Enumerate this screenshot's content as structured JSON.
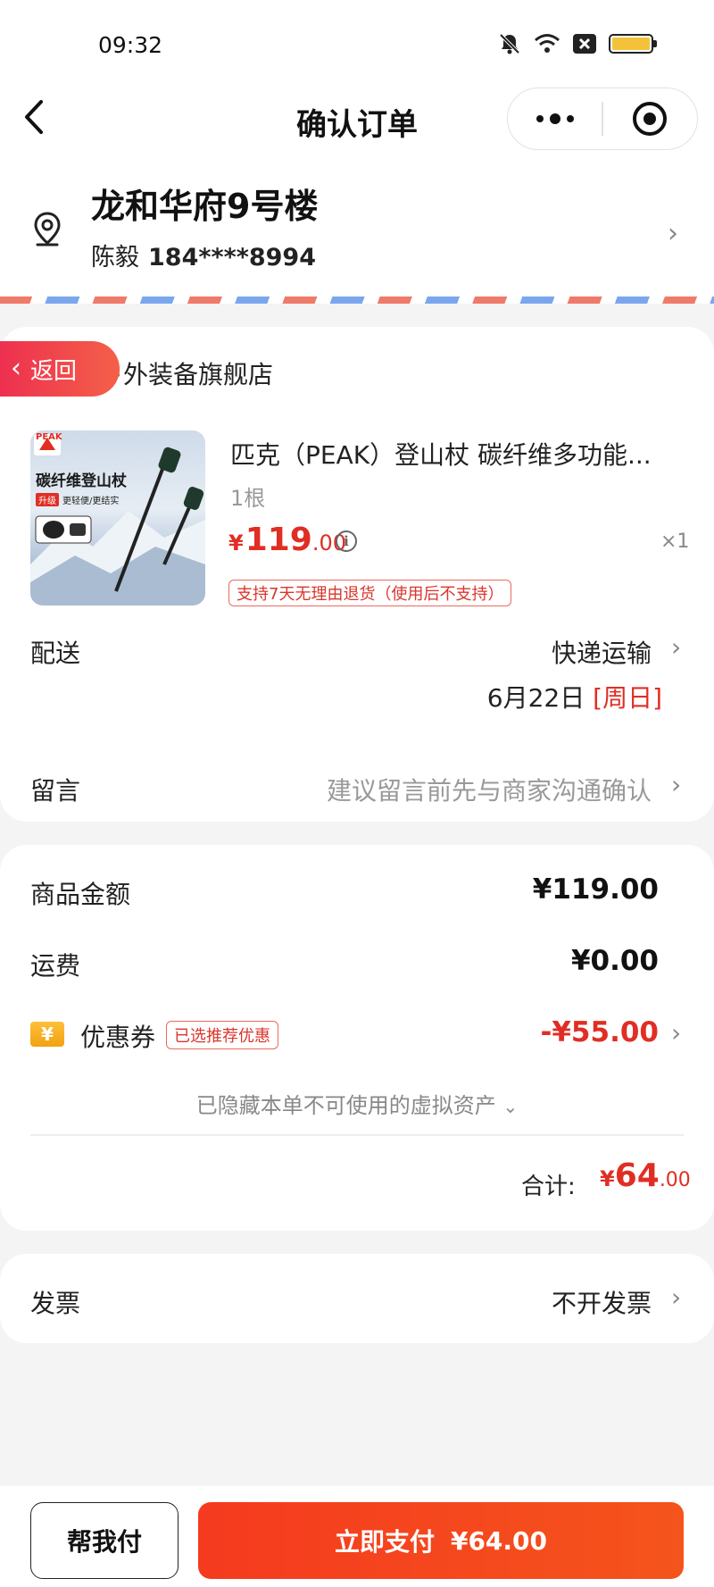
{
  "status_bar": {
    "time": "09:32"
  },
  "header": {
    "title": "确认订单",
    "back_icon": "chevron-left-icon",
    "more_icon": "more-dots-icon",
    "close_icon": "target-icon"
  },
  "address": {
    "name": "龙和华府9号楼",
    "contact_name": "陈毅",
    "phone": "184****8994"
  },
  "order": {
    "return_label": "返回",
    "store_name": "户外装备旗舰店",
    "product": {
      "brand_logo": "PEAK",
      "image_title": "碳纤维登山杖",
      "image_tag": "升级",
      "image_sub": "更轻便/更结实",
      "title": "匹克（PEAK）登山杖 碳纤维多功能...",
      "spec": "1根",
      "price_currency": "¥",
      "price_int": "119",
      "price_dec": ".00",
      "quantity": "×1",
      "refund_tag": "支持7天无理由退货（使用后不支持）"
    },
    "delivery": {
      "label": "配送",
      "value": "快递运输",
      "date": "6月22日",
      "weekday": "[周日]"
    },
    "message": {
      "label": "留言",
      "placeholder": "建议留言前先与商家沟通确认"
    }
  },
  "summary": {
    "goods_label": "商品金额",
    "goods_value": "¥119.00",
    "shipping_label": "运费",
    "shipping_value": "¥0.00",
    "coupon_icon_text": "¥",
    "coupon_label": "优惠券",
    "coupon_tag": "已选推荐优惠",
    "coupon_value": "-¥55.00",
    "hidden_note": "已隐藏本单不可使用的虚拟资产",
    "total_label": "合计:",
    "total_currency": "¥",
    "total_int": "64",
    "total_dec": ".00"
  },
  "invoice": {
    "label": "发票",
    "value": "不开发票"
  },
  "footer": {
    "help_pay": "帮我付",
    "pay_label": "立即支付",
    "pay_amount": "¥64.00"
  },
  "colors": {
    "accent": "#e02e24",
    "pay_button": "#f53a1f",
    "coupon_icon": "#f8b12c"
  }
}
